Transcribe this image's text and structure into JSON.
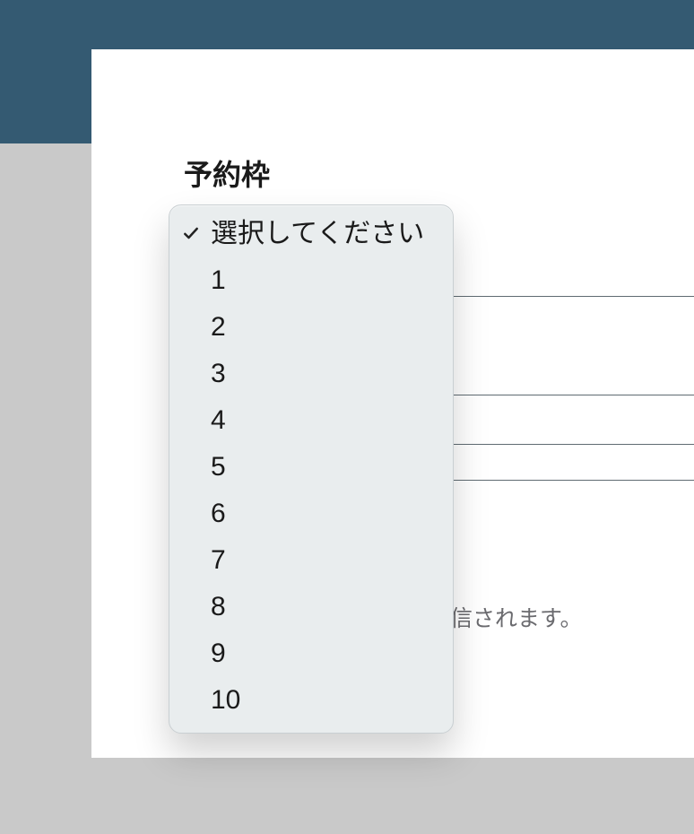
{
  "field": {
    "label": "予約枠"
  },
  "hint": {
    "text_fragment": "信されます。"
  },
  "dropdown": {
    "selected_index": 0,
    "options": [
      "選択してください",
      "1",
      "2",
      "3",
      "4",
      "5",
      "6",
      "7",
      "8",
      "9",
      "10"
    ]
  }
}
